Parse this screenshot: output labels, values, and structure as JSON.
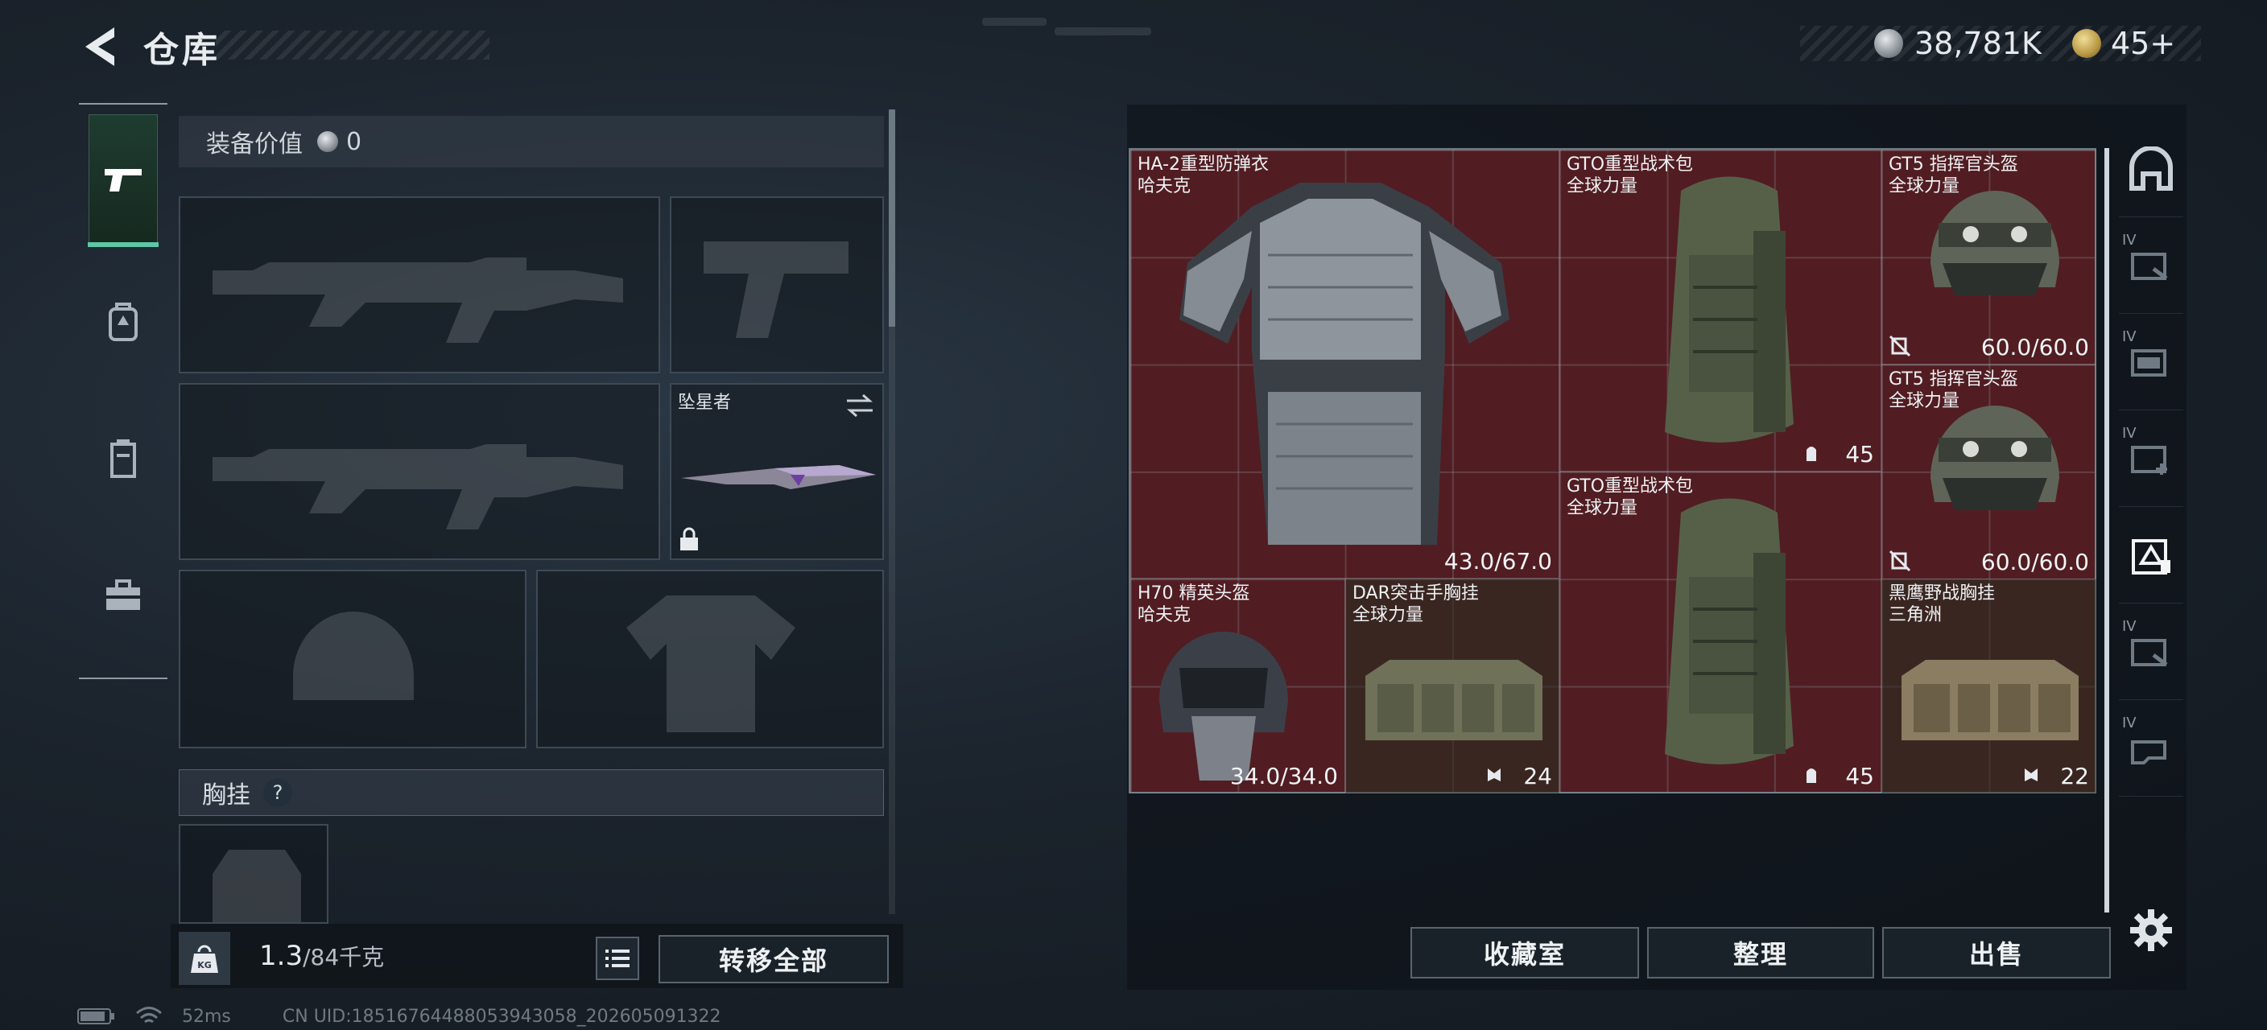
{
  "header": {
    "title": "仓库",
    "currency": [
      {
        "icon": "silver-coin-icon",
        "value": "38,781K"
      },
      {
        "icon": "gold-coin-icon",
        "value": "45+"
      }
    ]
  },
  "side_nav": {
    "items": [
      {
        "icon": "pistol-icon",
        "active": true
      },
      {
        "icon": "backpack-icon",
        "active": false
      },
      {
        "icon": "locker-icon",
        "active": false
      },
      {
        "icon": "toolbox-icon",
        "active": false
      }
    ]
  },
  "loadout": {
    "value_label": "装备价值",
    "value": "0",
    "knife_name": "坠星者",
    "rig_label": "胸挂",
    "rig_help": "?",
    "weight_current": "1.3",
    "weight_max": "/84千克",
    "weight_icon_text": "KG",
    "transfer_all": "转移全部"
  },
  "storage": {
    "items": [
      {
        "name": "HA-2重型防弹衣\n哈夫克",
        "value": "43.0/67.0",
        "type": "armor"
      },
      {
        "name": "GTO重型战术包\n全球力量",
        "value": "45",
        "type": "backpack"
      },
      {
        "name": "GT5 指挥官头盔\n全球力量",
        "value": "60.0/60.0",
        "type": "helmet"
      },
      {
        "name": "GT5 指挥官头盔\n全球力量",
        "value": "60.0/60.0",
        "type": "helmet"
      },
      {
        "name": "GTO重型战术包\n全球力量",
        "value": "45",
        "type": "backpack"
      },
      {
        "name": "H70 精英头盔\n哈夫克",
        "value": "34.0/34.0",
        "type": "helmet"
      },
      {
        "name": "DAR突击手胸挂\n全球力量",
        "value": "24",
        "type": "rig"
      },
      {
        "name": "黑鹰野战胸挂\n三角洲",
        "value": "22",
        "type": "rig"
      }
    ]
  },
  "actions": {
    "collection": "收藏室",
    "sort": "整理",
    "sell": "出售"
  },
  "tabs": [
    {
      "icon": "safehouse-icon",
      "label": ""
    },
    {
      "icon": "storage-tab-1-icon",
      "label": "IV"
    },
    {
      "icon": "storage-tab-2-icon",
      "label": "IV"
    },
    {
      "icon": "storage-tab-3-icon",
      "label": "IV"
    },
    {
      "icon": "storage-tab-4-icon",
      "label": ""
    },
    {
      "icon": "storage-tab-5-icon",
      "label": "IV"
    },
    {
      "icon": "storage-tab-6-icon",
      "label": "IV"
    }
  ],
  "status": {
    "ping": "52ms",
    "uid": "CN UID:18516764488053943058_202605091322"
  },
  "colors": {
    "accent_green": "#5ec7a3",
    "grid_red": "#511d22"
  }
}
